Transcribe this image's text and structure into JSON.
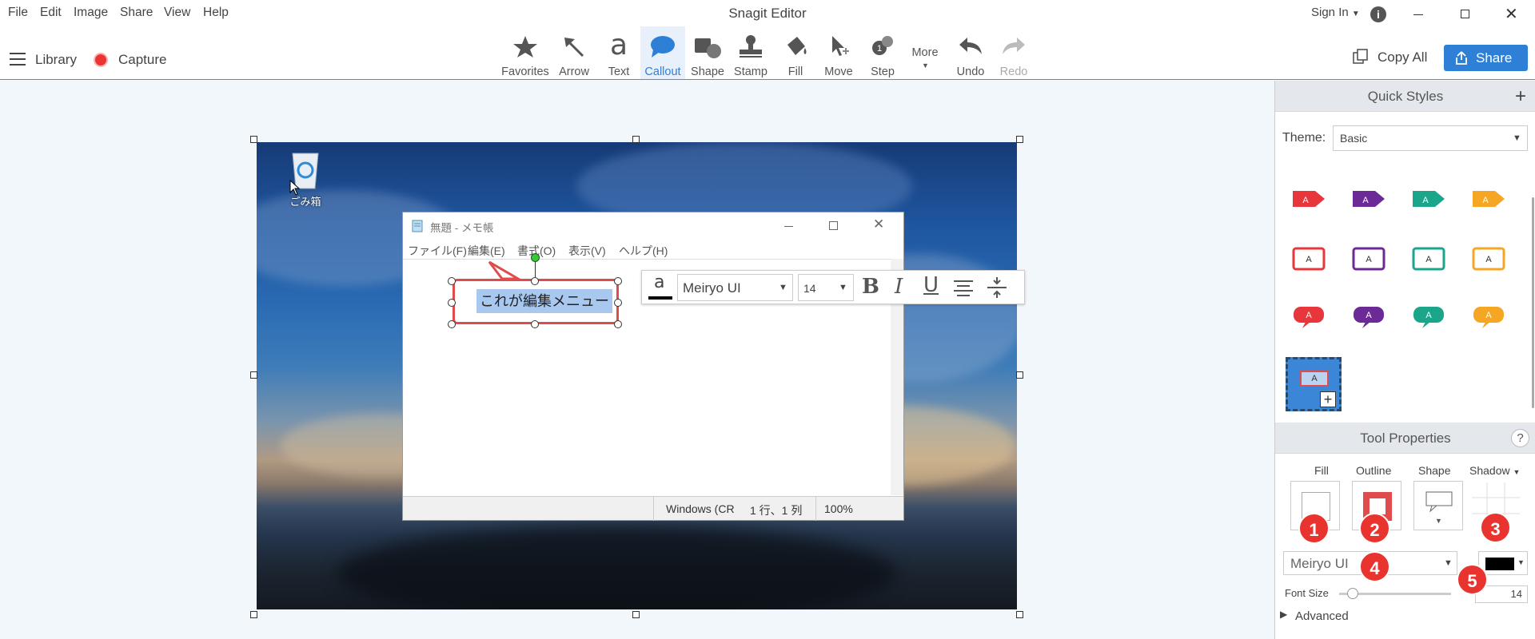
{
  "menu": [
    "File",
    "Edit",
    "Image",
    "Share",
    "View",
    "Help"
  ],
  "window": {
    "title": "Snagit Editor",
    "sign_in": "Sign In"
  },
  "nav": {
    "library": "Library",
    "capture": "Capture"
  },
  "tools": [
    {
      "label": "Favorites",
      "icon": "star-icon"
    },
    {
      "label": "Arrow",
      "icon": "arrow-icon"
    },
    {
      "label": "Text",
      "icon": "text-icon"
    },
    {
      "label": "Callout",
      "icon": "callout-icon",
      "active": true
    },
    {
      "label": "Shape",
      "icon": "shape-icon"
    },
    {
      "label": "Stamp",
      "icon": "stamp-icon"
    },
    {
      "label": "Fill",
      "icon": "fill-icon"
    },
    {
      "label": "Move",
      "icon": "move-icon"
    },
    {
      "label": "Step",
      "icon": "step-icon"
    },
    {
      "label": "More",
      "icon": "more-icon"
    },
    {
      "label": "Undo",
      "icon": "undo-icon"
    },
    {
      "label": "Redo",
      "icon": "redo-icon",
      "disabled": true
    }
  ],
  "actions": {
    "copy_all": "Copy All",
    "share": "Share"
  },
  "canvas": {
    "recycle_bin_label": "ごみ箱",
    "notepad": {
      "title": "無題 - メモ帳",
      "menu": [
        "ファイル(F)",
        "編集(E)",
        "書式(O)",
        "表示(V)",
        "ヘルプ(H)"
      ],
      "status": {
        "encoding": "Windows (CR",
        "position": "1 行、1 列",
        "zoom": "100%"
      }
    },
    "callout_text": "これが編集メニュー",
    "format_bar": {
      "text_color_glyph": "a",
      "font": "Meiryo UI",
      "size": "14",
      "bold": "B",
      "italic": "I",
      "underline": "U"
    }
  },
  "quick_styles": {
    "title": "Quick Styles",
    "theme_label": "Theme:",
    "theme_value": "Basic",
    "colors": [
      "#e8373c",
      "#6c2a96",
      "#1ba68c",
      "#f5a623"
    ],
    "style_glyph": "A"
  },
  "tool_properties": {
    "title": "Tool Properties",
    "help": "?",
    "fill_label": "Fill",
    "outline_label": "Outline",
    "shape_label": "Shape",
    "shadow_label": "Shadow",
    "font": "Meiryo UI",
    "font_size_label": "Font Size",
    "font_size_value": "14",
    "advanced_label": "Advanced",
    "badges": [
      "1",
      "2",
      "3",
      "4",
      "5"
    ]
  }
}
